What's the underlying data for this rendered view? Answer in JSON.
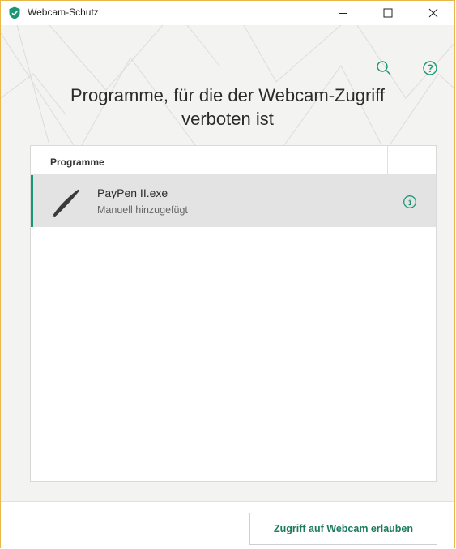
{
  "window": {
    "title": "Webcam-Schutz",
    "minimize": "—",
    "maximize": "☐",
    "close": "✕"
  },
  "header": {
    "title_line1": "Programme, für die der Webcam-Zugriff",
    "title_line2": "verboten ist"
  },
  "list": {
    "columns": [
      "Programme",
      ""
    ],
    "rows": [
      {
        "name": "PayPen II.exe",
        "subtitle": "Manuell hinzugefügt",
        "icon": "pen-icon"
      }
    ]
  },
  "footer": {
    "allow_button": "Zugriff auf Webcam erlauben"
  },
  "colors": {
    "accent": "#1b9674",
    "button_text": "#1b7a5e",
    "window_border": "#e8b84a"
  }
}
